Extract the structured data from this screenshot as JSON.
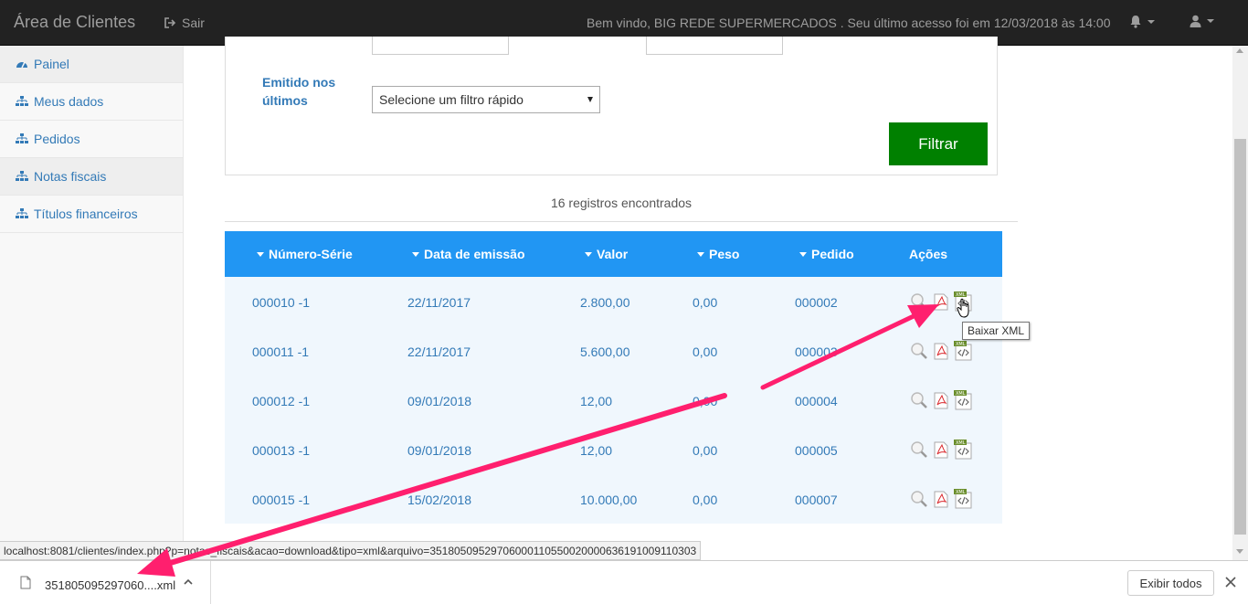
{
  "navbar": {
    "brand": "Área de Clientes",
    "logout_label": "Sair",
    "welcome": "Bem vindo, BIG REDE SUPERMERCADOS . Seu último acesso foi em 12/03/2018 às 14:00"
  },
  "sidebar": {
    "items": [
      {
        "label": "Painel",
        "icon": "dashboard-icon"
      },
      {
        "label": "Meus dados",
        "icon": "sitemap-icon"
      },
      {
        "label": "Pedidos",
        "icon": "sitemap-icon"
      },
      {
        "label": "Notas fiscais",
        "icon": "sitemap-icon"
      },
      {
        "label": "Títulos financeiros",
        "icon": "sitemap-icon"
      }
    ]
  },
  "filter": {
    "emit_label": "Emitido nos últimos",
    "quick_filter_value": "Selecione um filtro rápido",
    "submit_label": "Filtrar"
  },
  "records_text": "16 registros encontrados",
  "table": {
    "headers": [
      "Número-Série",
      "Data de emissão",
      "Valor",
      "Peso",
      "Pedido",
      "Ações"
    ],
    "rows": [
      {
        "numero": "000010 -1",
        "data": "22/11/2017",
        "valor": "2.800,00",
        "peso": "0,00",
        "pedido": "000002"
      },
      {
        "numero": "000011 -1",
        "data": "22/11/2017",
        "valor": "5.600,00",
        "peso": "0,00",
        "pedido": "000003"
      },
      {
        "numero": "000012 -1",
        "data": "09/01/2018",
        "valor": "12,00",
        "peso": "0,00",
        "pedido": "000004"
      },
      {
        "numero": "000013 -1",
        "data": "09/01/2018",
        "valor": "12,00",
        "peso": "0,00",
        "pedido": "000005"
      },
      {
        "numero": "000015 -1",
        "data": "15/02/2018",
        "valor": "10.000,00",
        "peso": "0,00",
        "pedido": "000007"
      }
    ]
  },
  "tooltip": "Baixar XML",
  "status_url": "localhost:8081/clientes/index.php?p=notas_fiscais&acao=download&tipo=xml&arquivo=35180509529706000110550020000636191009110303",
  "download": {
    "filename": "351805095297060....xml",
    "show_all_label": "Exibir todos"
  },
  "colors": {
    "navbar_bg": "#222222",
    "table_header_bg": "#2196f3",
    "filter_button_bg": "#008000",
    "annotation_arrow": "#ff1f6e"
  }
}
